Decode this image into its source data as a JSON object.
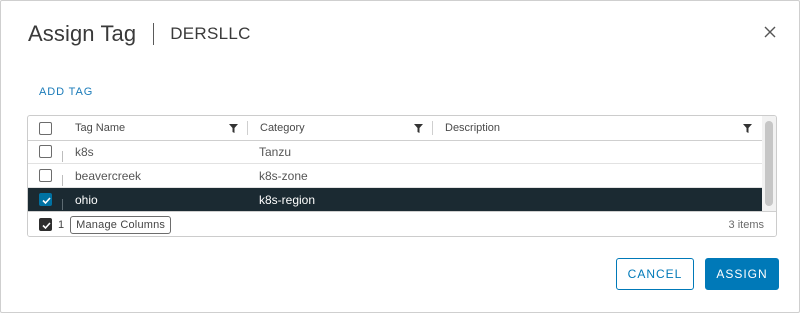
{
  "dialog": {
    "title": "Assign Tag",
    "subtitle": "DERSLLC",
    "add_tag": "ADD TAG"
  },
  "grid": {
    "columns": [
      {
        "label": "Tag Name"
      },
      {
        "label": "Category"
      },
      {
        "label": "Description"
      }
    ],
    "rows": [
      {
        "name": "k8s",
        "category": "Tanzu",
        "description": "",
        "checked": false
      },
      {
        "name": "beavercreek",
        "category": "k8s-zone",
        "description": "",
        "checked": false
      },
      {
        "name": "ohio",
        "category": "k8s-region",
        "description": "",
        "checked": true
      }
    ],
    "footer": {
      "selected_count": "1",
      "manage_columns": "Manage Columns",
      "items_count": "3 items"
    }
  },
  "buttons": {
    "cancel": "CANCEL",
    "assign": "ASSIGN"
  },
  "colors": {
    "accent": "#0079b8",
    "selected_row": "#1b2a32"
  },
  "icons": [
    "close-icon",
    "filter-icon",
    "checkmark-icon"
  ]
}
